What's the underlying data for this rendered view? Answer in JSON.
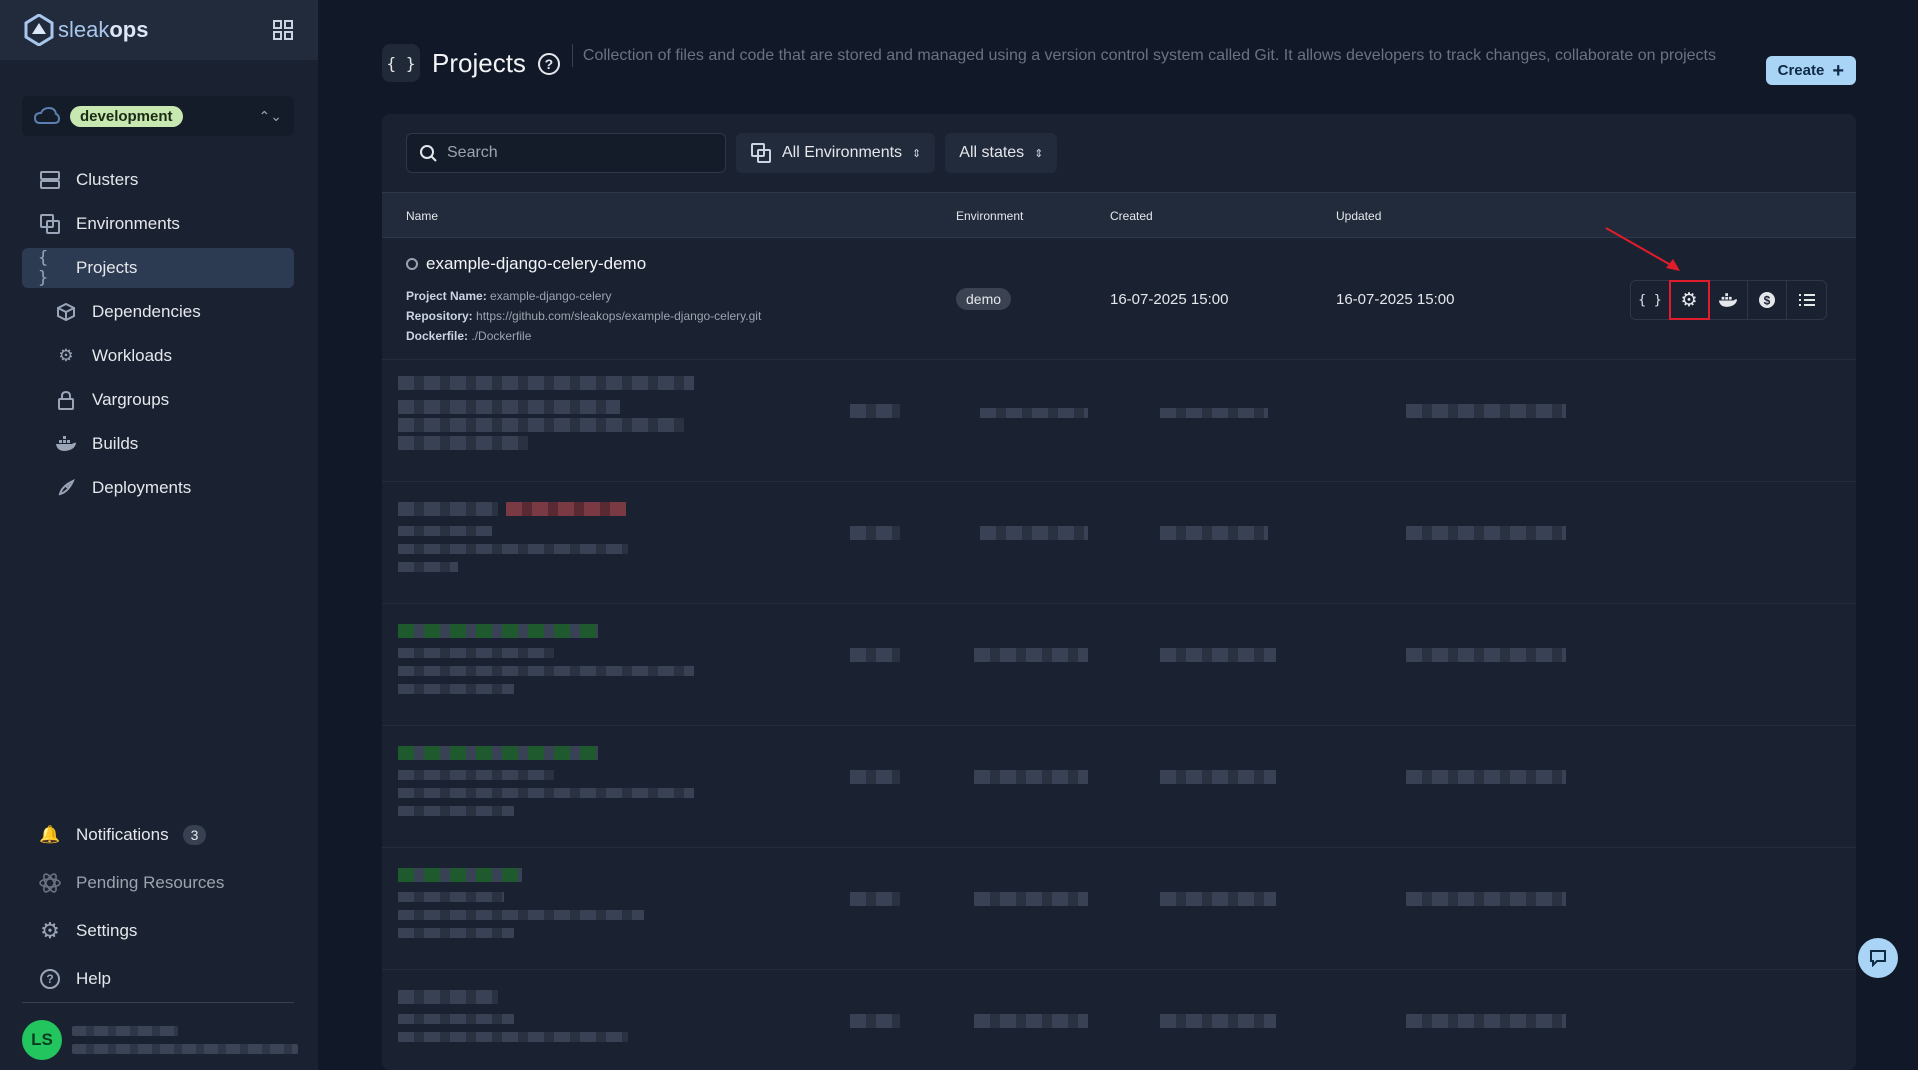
{
  "brand": {
    "name_part1": "sleak",
    "name_part2": "ops"
  },
  "environment_selector": {
    "value": "development"
  },
  "nav": {
    "items": [
      {
        "label": "Clusters"
      },
      {
        "label": "Environments"
      },
      {
        "label": "Projects"
      },
      {
        "label": "Dependencies"
      },
      {
        "label": "Workloads"
      },
      {
        "label": "Vargroups"
      },
      {
        "label": "Builds"
      },
      {
        "label": "Deployments"
      }
    ],
    "bottom": [
      {
        "label": "Notifications",
        "count": "3"
      },
      {
        "label": "Pending Resources"
      },
      {
        "label": "Settings"
      },
      {
        "label": "Help"
      }
    ]
  },
  "user": {
    "initials": "LS"
  },
  "header": {
    "icon_text": "{ }",
    "title": "Projects",
    "description": "Collection of files and code that are stored and managed using a version control system called Git. It allows developers to track changes, collaborate on projects",
    "create_label": "Create"
  },
  "filters": {
    "search_placeholder": "Search",
    "environment": "All Environments",
    "state": "All states"
  },
  "table": {
    "columns": [
      "Name",
      "Environment",
      "Created",
      "Updated"
    ],
    "first_row": {
      "name": "example-django-celery-demo",
      "project_name_label": "Project Name:",
      "project_name": "example-django-celery",
      "repository_label": "Repository:",
      "repository": "https://github.com/sleakops/example-django-celery.git",
      "dockerfile_label": "Dockerfile:",
      "dockerfile": "./Dockerfile",
      "environment": "demo",
      "created": "16-07-2025 15:00",
      "updated": "16-07-2025 15:00"
    }
  },
  "colors": {
    "accent": "#a9d4f5",
    "highlight": "#e11d2b",
    "env_badge": "#c7e8b1"
  }
}
